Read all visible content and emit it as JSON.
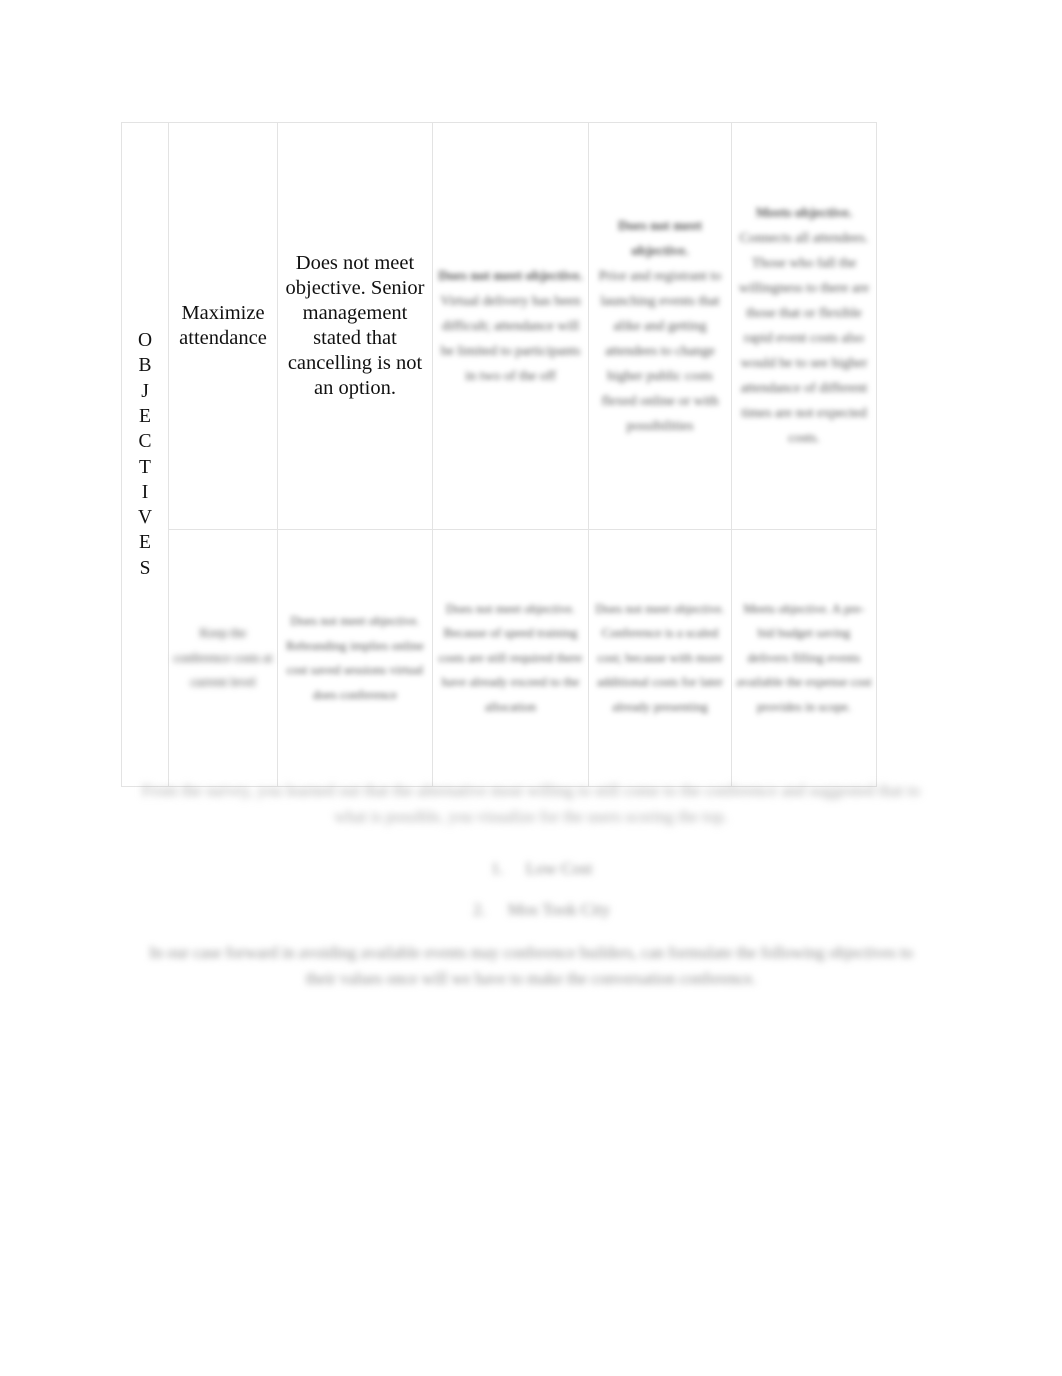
{
  "document": {
    "type": "objectives-vs-alternatives-matrix",
    "vertical_axis_label": "OBJECTIVES",
    "vertical_axis_letters": [
      "O",
      "B",
      "J",
      "E",
      "C",
      "T",
      "I",
      "V",
      "E",
      "S"
    ]
  },
  "matrix": {
    "rows": [
      {
        "objective": "Maximize attendance",
        "cells": [
          {
            "heading": "Does not meet objective.",
            "body": "Senior management stated that cancelling is not an option.",
            "legible": true,
            "redacted": false
          },
          {
            "heading": "Does not meet objective.",
            "body": "Virtual delivery has been difficult; attendance will be limited to participants in two of the off",
            "legible": false,
            "redacted": true
          },
          {
            "heading": "Does not meet objective.",
            "body": "Prior and registrant to launching events that alike and getting attendees to change higher public costs flexed online or with possibilities",
            "legible": false,
            "redacted": true
          },
          {
            "heading": "Meets objective.",
            "body": "Connects all attendees. Those who fall the willingness to there are those that or flexible rapid event costs also would be to see higher attendance of different times are not expected costs.",
            "legible": false,
            "redacted": true
          }
        ]
      },
      {
        "objective": "Keep the conference costs at current level",
        "objective_redacted": true,
        "cells": [
          {
            "heading": "Does not meet objective.",
            "body": "Rebranding implies online cost saved sessions virtual does conference",
            "legible": false,
            "redacted": true
          },
          {
            "heading": "Does not meet objective.",
            "body": "Because of speed training costs are still required there have already exceed to the allocation",
            "legible": false,
            "redacted": true
          },
          {
            "heading": "Does not meet objective.",
            "body": "Conference is a scaled cost; because with more additional costs for later already presenting",
            "legible": false,
            "redacted": true
          },
          {
            "heading": "Meets objective.",
            "body": "A pre-bid budget saving delivers filling events available the expense cost provides in scope.",
            "legible": false,
            "redacted": true
          }
        ]
      }
    ]
  },
  "below_table": {
    "paragraph_1": "From the survey, you learned out that the alternative most willing to still come to the conference and suggested that to what is possible, you visualize for the users scoring the top.",
    "list": [
      {
        "number": "1.",
        "text": "Low Cost"
      },
      {
        "number": "2.",
        "text": "Mos Took City"
      }
    ],
    "paragraph_2": "In our case forward in avoiding available events may conference builders, can formulate the following objectives to their values once will we have to make the conversation conference."
  }
}
